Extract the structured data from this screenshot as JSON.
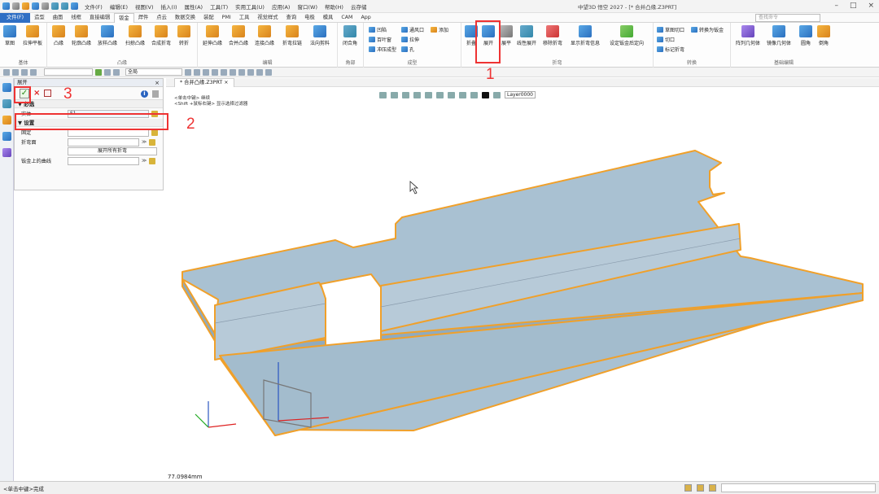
{
  "app_title": "中望3D 悟空 2027",
  "doc_title": "- [* 合并凸缘.Z3PRT]",
  "menus": [
    "文件(F)",
    "编辑(E)",
    "视图(V)",
    "插入(I)",
    "属性(A)",
    "工具(T)",
    "实用工具(U)",
    "应用(A)",
    "窗口(W)",
    "帮助(H)",
    "云存储"
  ],
  "tabs": [
    "文件(F)",
    "造型",
    "曲面",
    "线框",
    "直接编辑",
    "钣金",
    "焊件",
    "点云",
    "数据交换",
    "装配",
    "PMI",
    "工具",
    "视觉样式",
    "查询",
    "电极",
    "模具",
    "CAM",
    "App"
  ],
  "active_tab_index": 5,
  "search_placeholder": "查找命令",
  "ribbon": {
    "groups": [
      {
        "label": "基体",
        "tools": [
          "草图",
          "拉伸平板"
        ]
      },
      {
        "label": "凸缘",
        "tools": [
          "凸缘",
          "轮廓凸缘",
          "放样凸缘",
          "扫掠凸缘",
          "合成折弯",
          "转折"
        ]
      },
      {
        "label": "编辑",
        "tools": [
          "延伸凸缘",
          "合并凸缘",
          "连接凸缘",
          "折弯拉链",
          "法向剪料"
        ]
      },
      {
        "label": "角部",
        "tools": [
          "闭合角"
        ]
      },
      {
        "label": "成型",
        "tools": [
          "凹陷",
          "百叶窗",
          "冲压成型",
          "通风口",
          "拉伸",
          "孔",
          "添加"
        ]
      },
      {
        "label": "折弯",
        "tools": [
          "折叠",
          "展开",
          "展平",
          "线性展开",
          "移除折弯",
          "显示折弯信息",
          "设定钣金后定向"
        ]
      },
      {
        "label": "转换",
        "tools": [
          "草图切口",
          "转换为钣金",
          "切口",
          "标记折弯"
        ]
      },
      {
        "label": "基础编辑",
        "tools": [
          "阵列几何体",
          "镜像几何体",
          "圆角",
          "倒角"
        ]
      }
    ]
  },
  "view_combo": "全局",
  "layer": "Layer0000",
  "panel": {
    "title": "展开",
    "section_required": "必选",
    "section_settings": "设置",
    "fields": {
      "entity_label": "实体",
      "entity_value": "S1",
      "fixed_label": "固定",
      "fixed_value": "",
      "bend_label": "折弯面",
      "bend_value": "",
      "unfold_all": "展开所有折弯",
      "curve_label": "钣金上的曲线",
      "curve_value": ""
    }
  },
  "doc_tab": "* 合并凸缘.Z3PRT",
  "prompt_lines": [
    "<单击中键> 继续",
    "<Shift +鼠标右键> 显示选择过滤器"
  ],
  "measure": "77.0984mm",
  "status_text": "<单击中键>完成",
  "annotations": {
    "n1": "1",
    "n2": "2",
    "n3": "3"
  },
  "colors": {
    "accent": "#2f6fc4",
    "model_face": "#a6bfd0",
    "model_edge": "#f0a02a",
    "annotation": "#e33333"
  }
}
